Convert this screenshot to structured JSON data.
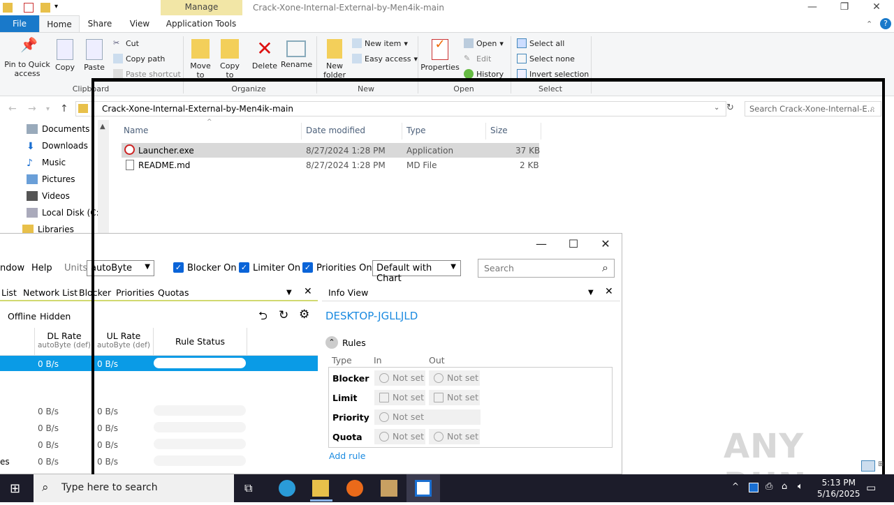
{
  "explorer": {
    "contextual_tab": "Manage",
    "window_title": "Crack-Xone-Internal-External-by-Men4ik-main",
    "tabs": {
      "file": "File",
      "home": "Home",
      "share": "Share",
      "view": "View",
      "app_tools": "Application Tools"
    },
    "ribbon": {
      "pin": "Pin to Quick access",
      "copy": "Copy",
      "paste": "Paste",
      "cut": "Cut",
      "copy_path": "Copy path",
      "paste_shortcut": "Paste shortcut",
      "move_to": "Move to",
      "copy_to": "Copy to",
      "delete": "Delete",
      "rename": "Rename",
      "new_folder": "New folder",
      "new_item": "New item",
      "easy_access": "Easy access",
      "properties": "Properties",
      "open": "Open",
      "edit": "Edit",
      "history": "History",
      "select_all": "Select all",
      "select_none": "Select none",
      "invert_selection": "Invert selection",
      "groups": {
        "clipboard": "Clipboard",
        "organize": "Organize",
        "new": "New",
        "open": "Open",
        "select": "Select"
      }
    },
    "address": "Crack-Xone-Internal-External-by-Men4ik-main",
    "search_placeholder": "Search Crack-Xone-Internal-E...",
    "nav": [
      "Documents",
      "Downloads",
      "Music",
      "Pictures",
      "Videos",
      "Local Disk (C:)",
      "Libraries"
    ],
    "columns": {
      "name": "Name",
      "date": "Date modified",
      "type": "Type",
      "size": "Size"
    },
    "files": [
      {
        "name": "Launcher.exe",
        "date": "8/27/2024 1:28 PM",
        "type": "Application",
        "size": "37 KB"
      },
      {
        "name": "README.md",
        "date": "8/27/2024 1:28 PM",
        "type": "MD File",
        "size": "2 KB"
      }
    ]
  },
  "netlimiter": {
    "menu": {
      "window": "ndow",
      "help": "Help"
    },
    "units_label": "Units",
    "units_value": "autoByte",
    "checks": {
      "blocker": "Blocker On",
      "limiter": "Limiter On",
      "priorities": "Priorities On"
    },
    "profile": "Default with Chart",
    "search_placeholder": "Search",
    "left_tabs": {
      "list": "List",
      "network": "Network List",
      "blocker": "Blocker",
      "priorities": "Priorities",
      "quotas": "Quotas"
    },
    "filters": {
      "offline": "Offline",
      "hidden": "Hidden"
    },
    "headers": {
      "dl": "DL Rate",
      "dl_sub": "autoByte (def)",
      "ul": "UL Rate",
      "ul_sub": "autoByte (def)",
      "rule": "Rule Status"
    },
    "rows": [
      {
        "dl": "0 B/s",
        "ul": "0 B/s"
      },
      {
        "dl": "0 B/s",
        "ul": "0 B/s"
      },
      {
        "dl": "0 B/s",
        "ul": "0 B/s"
      },
      {
        "dl": "0 B/s",
        "ul": "0 B/s"
      },
      {
        "dl": "0 B/s",
        "ul": "0 B/s",
        "name_tail": "es"
      }
    ],
    "info": {
      "header": "Info View",
      "machine": "DESKTOP-JGLLJLD",
      "rules": "Rules",
      "col_type": "Type",
      "col_in": "In",
      "col_out": "Out",
      "rule_rows": [
        "Blocker",
        "Limit",
        "Priority",
        "Quota"
      ],
      "not_set": "Not set",
      "add_rule": "Add rule"
    }
  },
  "taskbar": {
    "search": "Type here to search",
    "time": "5:13 PM",
    "date": "5/16/2025"
  },
  "watermark": "ANY RUN"
}
